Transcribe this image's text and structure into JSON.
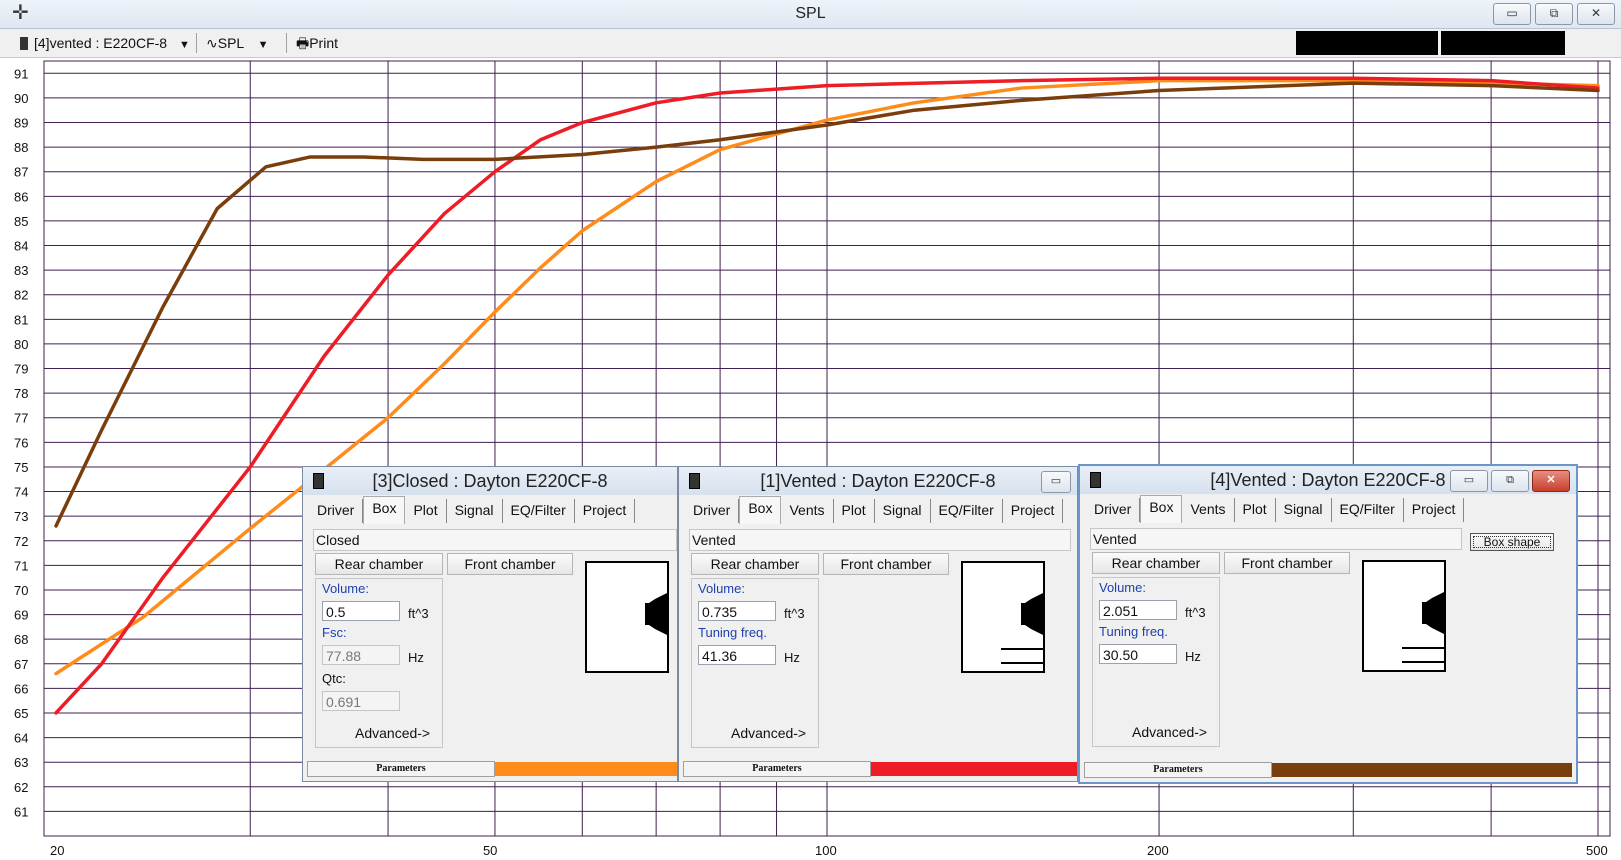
{
  "window": {
    "title": "SPL",
    "controls": [
      "▭",
      "⧉",
      "✕"
    ]
  },
  "toolbar": {
    "driver_select": "[4]vented : E220CF-8",
    "plot_select": "SPL",
    "print_label": "Print"
  },
  "plot": {
    "y_ticks": [
      91,
      90,
      89,
      88,
      87,
      86,
      85,
      84,
      83,
      82,
      81,
      80,
      79,
      78,
      77,
      76,
      75,
      74,
      73,
      72,
      71,
      70,
      69,
      68,
      67,
      66,
      65,
      64,
      63,
      62,
      61
    ],
    "x_labels": [
      "20",
      "50",
      "100",
      "200",
      "500"
    ],
    "grid_color": "#3f1f4f",
    "curves": [
      {
        "color": "#ff8c1a",
        "points": [
          [
            20,
            66.6
          ],
          [
            24,
            68.9
          ],
          [
            30,
            72.5
          ],
          [
            35,
            74.9
          ],
          [
            40,
            77.0
          ],
          [
            45,
            79.2
          ],
          [
            50,
            81.3
          ],
          [
            55,
            83.1
          ],
          [
            60,
            84.6
          ],
          [
            70,
            86.6
          ],
          [
            80,
            87.9
          ],
          [
            100,
            89.1
          ],
          [
            120,
            89.8
          ],
          [
            150,
            90.4
          ],
          [
            200,
            90.7
          ],
          [
            300,
            90.7
          ],
          [
            400,
            90.6
          ],
          [
            500,
            90.5
          ]
        ]
      },
      {
        "color": "#ee1c25",
        "points": [
          [
            20,
            65.0
          ],
          [
            22,
            67.0
          ],
          [
            25,
            70.5
          ],
          [
            30,
            75.0
          ],
          [
            35,
            79.5
          ],
          [
            40,
            82.8
          ],
          [
            45,
            85.3
          ],
          [
            50,
            87.0
          ],
          [
            55,
            88.3
          ],
          [
            60,
            89.0
          ],
          [
            70,
            89.8
          ],
          [
            80,
            90.2
          ],
          [
            100,
            90.5
          ],
          [
            150,
            90.7
          ],
          [
            200,
            90.8
          ],
          [
            300,
            90.8
          ],
          [
            400,
            90.7
          ],
          [
            500,
            90.4
          ]
        ]
      },
      {
        "color": "#7a3d0c",
        "points": [
          [
            20,
            72.6
          ],
          [
            22,
            76.5
          ],
          [
            25,
            81.5
          ],
          [
            28,
            85.5
          ],
          [
            31,
            87.2
          ],
          [
            34,
            87.6
          ],
          [
            38,
            87.6
          ],
          [
            43,
            87.5
          ],
          [
            50,
            87.5
          ],
          [
            60,
            87.7
          ],
          [
            70,
            88.0
          ],
          [
            80,
            88.3
          ],
          [
            100,
            88.9
          ],
          [
            120,
            89.5
          ],
          [
            150,
            89.9
          ],
          [
            200,
            90.3
          ],
          [
            300,
            90.6
          ],
          [
            400,
            90.5
          ],
          [
            500,
            90.3
          ]
        ]
      }
    ]
  },
  "child_windows": [
    {
      "title": "[3]Closed : Dayton E220CF-8",
      "tabs": [
        "Driver",
        "Box",
        "Plot",
        "Signal",
        "EQ/Filter",
        "Project"
      ],
      "selected_tab": "Box",
      "box_type": "Closed",
      "rear_chamber": "Rear chamber",
      "front_chamber": "Front chamber",
      "fields": [
        {
          "label": "Volume:",
          "value": "0.5",
          "unit": "ft^3",
          "readonly": false
        },
        {
          "label": "Fsc:",
          "value": "77.88",
          "unit": "Hz",
          "readonly": true
        },
        {
          "label": "Qtc:",
          "value": "0.691",
          "unit": "",
          "readonly": true
        }
      ],
      "advanced": "Advanced->",
      "status_label": "Parameters",
      "color": "#ff8c1a"
    },
    {
      "title": "[1]Vented : Dayton E220CF-8",
      "tabs": [
        "Driver",
        "Box",
        "Vents",
        "Plot",
        "Signal",
        "EQ/Filter",
        "Project"
      ],
      "selected_tab": "Box",
      "box_type": "Vented",
      "rear_chamber": "Rear chamber",
      "front_chamber": "Front chamber",
      "fields": [
        {
          "label": "Volume:",
          "value": "0.735",
          "unit": "ft^3",
          "readonly": false
        },
        {
          "label": "Tuning freq.",
          "value": "41.36",
          "unit": "Hz",
          "readonly": false
        }
      ],
      "advanced": "Advanced->",
      "status_label": "Parameters",
      "color": "#ee1c25"
    },
    {
      "title": "[4]Vented : Dayton E220CF-8",
      "tabs": [
        "Driver",
        "Box",
        "Vents",
        "Plot",
        "Signal",
        "EQ/Filter",
        "Project"
      ],
      "selected_tab": "Box",
      "box_type": "Vented",
      "box_shape": "Box shape",
      "rear_chamber": "Rear chamber",
      "front_chamber": "Front chamber",
      "fields": [
        {
          "label": "Volume:",
          "value": "2.051",
          "unit": "ft^3",
          "readonly": false
        },
        {
          "label": "Tuning freq.",
          "value": "30.50",
          "unit": "Hz",
          "readonly": false
        }
      ],
      "advanced": "Advanced->",
      "status_label": "Parameters",
      "color": "#7a3d0c"
    }
  ]
}
